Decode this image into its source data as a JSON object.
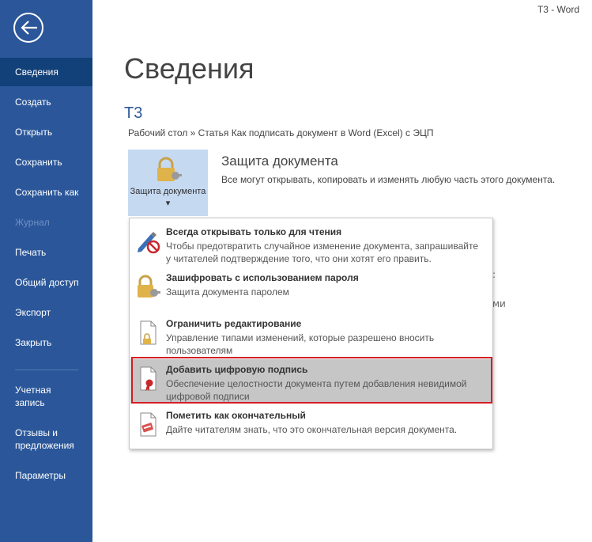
{
  "titlebar": {
    "text": "Т3  -  Word"
  },
  "sidebar": {
    "items": [
      {
        "label": "Сведения"
      },
      {
        "label": "Создать"
      },
      {
        "label": "Открыть"
      },
      {
        "label": "Сохранить"
      },
      {
        "label": "Сохранить как"
      },
      {
        "label": "Журнал"
      },
      {
        "label": "Печать"
      },
      {
        "label": "Общий доступ"
      },
      {
        "label": "Экспорт"
      },
      {
        "label": "Закрыть"
      },
      {
        "label": "Учетная запись"
      },
      {
        "label": "Отзывы и предложения"
      },
      {
        "label": "Параметры"
      }
    ]
  },
  "main": {
    "title": "Сведения",
    "doc_name": "Т3",
    "path": "Рабочий стол » Статья Как подписать документ в Word (Excel) с ЭЦП",
    "protect": {
      "button_label": "Защита документа ▾",
      "title": "Защита документа",
      "description": "Все могут открывать, копировать и изменять любую часть этого документа."
    },
    "behind_fragments": [
      ":",
      "ми"
    ]
  },
  "menu": {
    "items": [
      {
        "title": "Всегда открывать только для чтения",
        "desc": "Чтобы предотвратить случайное изменение документа, запрашивайте у читателей подтверждение того, что они хотят его править.",
        "icon": "pencil-no-icon"
      },
      {
        "title": "Зашифровать с использованием пароля",
        "desc": "Защита документа паролем",
        "icon": "lock-key-icon"
      },
      {
        "title": "Ограничить редактирование",
        "desc": "Управление типами изменений, которые разрешено вносить пользователям",
        "icon": "document-lock-icon"
      },
      {
        "title": "Добавить цифровую подпись",
        "desc": "Обеспечение целостности документа путем добавления невидимой цифровой подписи",
        "icon": "document-ribbon-icon"
      },
      {
        "title": "Пометить как окончательный",
        "desc": "Дайте читателям знать, что это окончательная версия документа.",
        "icon": "document-stamp-icon"
      }
    ]
  },
  "colors": {
    "sidebar": "#2b579a",
    "sidebar_active": "#124078",
    "highlight_border": "#d41e24",
    "accent": "#2b579a"
  }
}
